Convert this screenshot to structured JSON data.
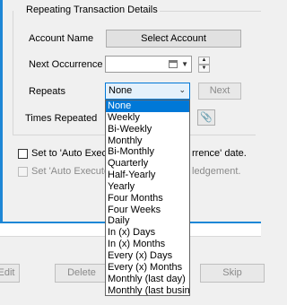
{
  "group": {
    "title": "Repeating Transaction Details"
  },
  "fields": {
    "account_name_label": "Account Name",
    "select_account_button": "Select Account",
    "next_occurrence_label": "Next Occurrence",
    "next_occurrence_value": "",
    "repeats_label": "Repeats",
    "repeats_value": "None",
    "next_button": "Next",
    "times_repeated_label": "Times Repeated"
  },
  "options": {
    "auto_execute_label": "Set to 'Auto Execu",
    "auto_execute_label_tail": "rrence' date.",
    "auto_execute_ack_label": "Set 'Auto Execute",
    "auto_execute_ack_label_tail": "ledgement."
  },
  "dropdown": {
    "selected_index": 0,
    "items": [
      "None",
      "Weekly",
      "Bi-Weekly",
      "Monthly",
      "Bi-Monthly",
      "Quarterly",
      "Half-Yearly",
      "Yearly",
      "Four Months",
      "Four Weeks",
      "Daily",
      "In (x) Days",
      "In (x) Months",
      "Every (x) Days",
      "Every (x) Months",
      "Monthly (last day)",
      "Monthly (last business day)"
    ]
  },
  "bottom": {
    "edit_label": "Edit",
    "delete_label": "Delete",
    "skip_label": "Skip"
  },
  "colors": {
    "accent": "#1e87d6",
    "selection": "#0078d7"
  }
}
